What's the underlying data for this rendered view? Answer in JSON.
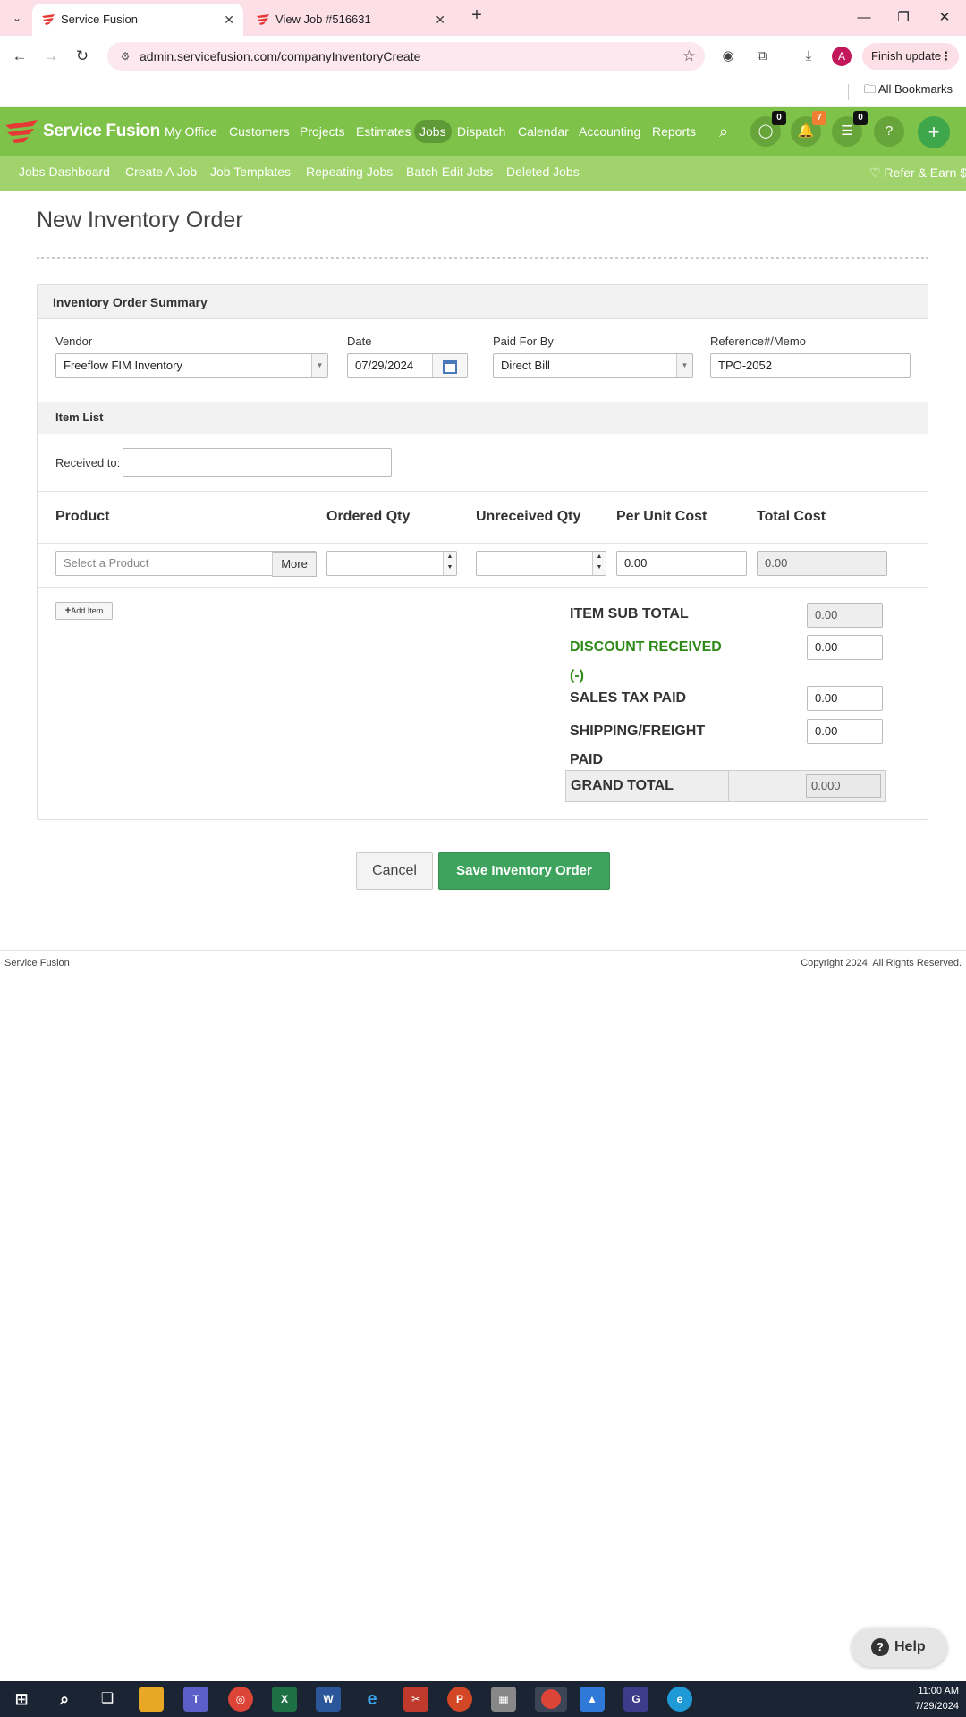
{
  "browser": {
    "tabs": [
      {
        "title": "Service Fusion",
        "active": true
      },
      {
        "title": "View Job #516631",
        "active": false
      }
    ],
    "url": "admin.servicefusion.com/companyInventoryCreate",
    "finish_update": "Finish update",
    "profile_initial": "A",
    "bookmarks_label": "All Bookmarks"
  },
  "app": {
    "brand": "Service Fusion",
    "nav": [
      "My Office",
      "Customers",
      "Projects",
      "Estimates",
      "Jobs",
      "Dispatch",
      "Calendar",
      "Accounting",
      "Reports"
    ],
    "active_nav": "Jobs",
    "badges": {
      "chat": "0",
      "notifications": "7",
      "tasks": "0"
    },
    "help_glyph": "?",
    "subnav": [
      "Jobs Dashboard",
      "Create A Job",
      "Job Templates",
      "Repeating Jobs",
      "Batch Edit Jobs",
      "Deleted Jobs"
    ],
    "refer": "Refer & Earn $"
  },
  "page": {
    "title": "New Inventory Order",
    "summary_header": "Inventory Order Summary",
    "vendor_label": "Vendor",
    "vendor_value": "Freeflow FIM Inventory",
    "date_label": "Date",
    "date_value": "07/29/2024",
    "paid_for_by_label": "Paid For By",
    "paid_for_by_value": "Direct Bill",
    "reference_label": "Reference#/Memo",
    "reference_value": "TPO-2052",
    "item_list_header": "Item List",
    "received_to_label": "Received to:",
    "received_to_value": "",
    "columns": [
      "Product",
      "Ordered Qty",
      "Unreceived Qty",
      "Per Unit Cost",
      "Total Cost"
    ],
    "row": {
      "product_placeholder": "Select a Product",
      "more_label": "More",
      "ordered_qty": "",
      "unreceived_qty": "",
      "per_unit_cost": "0.00",
      "total_cost": "0.00"
    },
    "add_item_label": "Add Item",
    "totals": {
      "item_sub_total_label": "ITEM SUB TOTAL",
      "item_sub_total": "0.00",
      "discount_label": "DISCOUNT RECEIVED",
      "discount_suffix": "(-)",
      "discount": "0.00",
      "sales_tax_label": "SALES TAX PAID",
      "sales_tax": "0.00",
      "shipping_label": "SHIPPING/FREIGHT",
      "shipping_label_2": "PAID",
      "shipping": "0.00",
      "grand_total_label": "GRAND TOTAL",
      "grand_total": "0.000"
    },
    "cancel_label": "Cancel",
    "save_label": "Save Inventory Order"
  },
  "footer": {
    "left": "Service Fusion",
    "right": "Copyright 2024. All Rights Reserved."
  },
  "help_label": "Help",
  "taskbar": {
    "time": "11:00 AM",
    "date": "7/29/2024"
  },
  "colors": {
    "header_green": "#7fc24a",
    "subnav_green": "#a0d36b",
    "save_green": "#3ea35c",
    "discount_green": "#2e8a17",
    "notif_orange": "#f07f33"
  }
}
